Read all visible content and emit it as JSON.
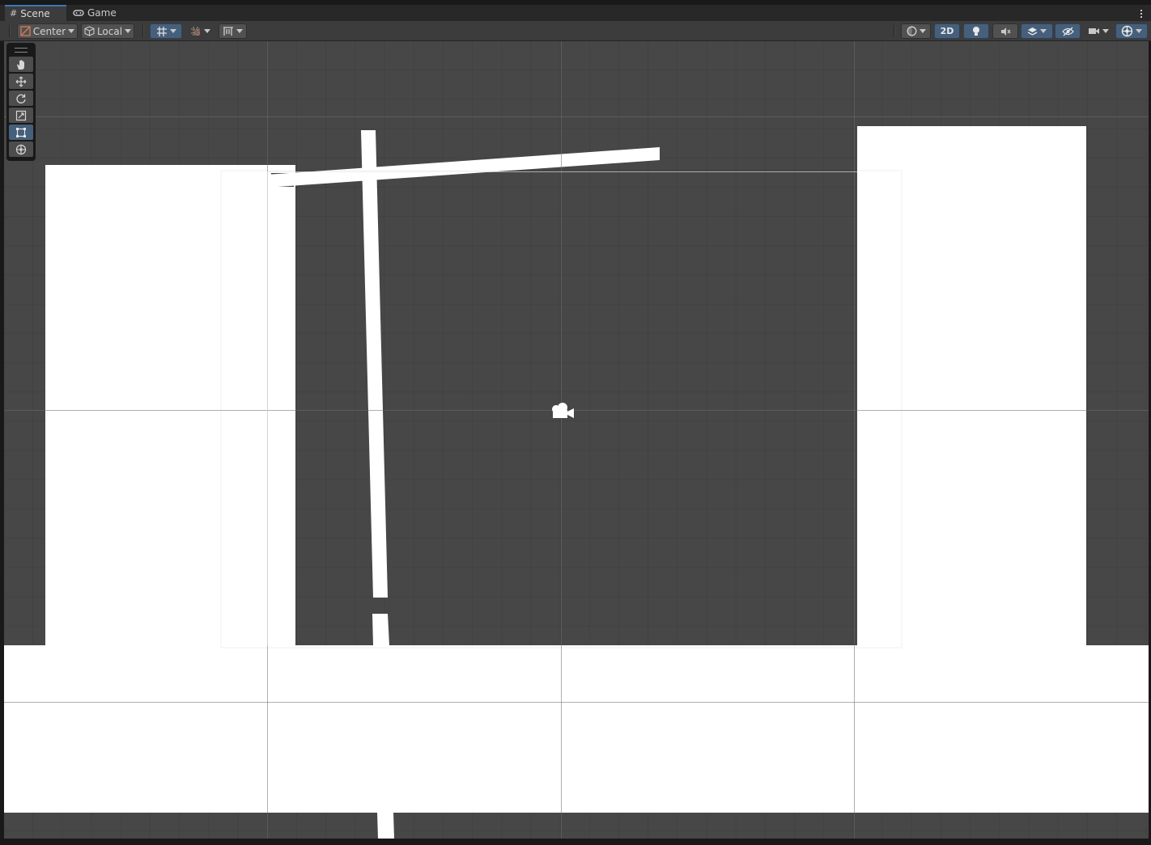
{
  "tabs": [
    {
      "label": "Scene",
      "icon": "grid-icon"
    },
    {
      "label": "Game",
      "icon": "gamepad-icon"
    }
  ],
  "toolbar": {
    "pivot_mode": "Center",
    "pivot_rotation": "Local",
    "view_2d_label": "2D"
  },
  "tools": [
    "hand-tool",
    "move-tool",
    "rotate-tool",
    "scale-tool",
    "rect-tool",
    "transform-tool"
  ],
  "active_tool": "rect-tool",
  "colors": {
    "accent": "#46607c",
    "viewport_bg": "#474747",
    "sprite": "#ffffff",
    "chrome": "#282828"
  }
}
